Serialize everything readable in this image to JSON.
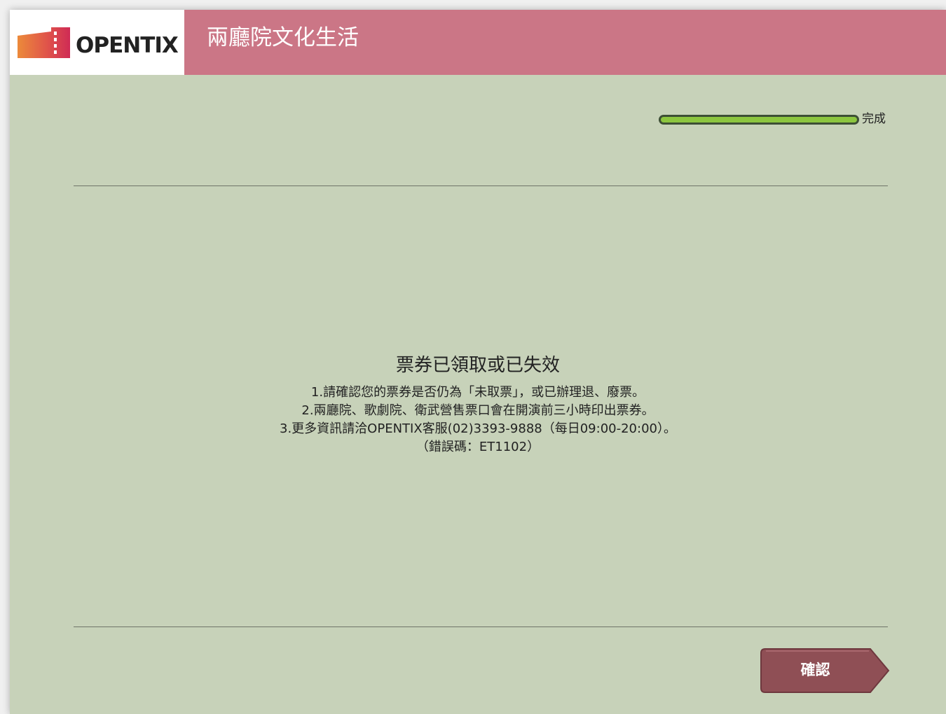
{
  "header": {
    "logo_text": "OPENTIX",
    "title": "兩廳院文化生活"
  },
  "progress": {
    "label": "完成",
    "fraction": 1.0
  },
  "message": {
    "title": "票券已領取或已失效",
    "lines": [
      "1.請確認您的票券是否仍為「未取票」，或已辦理退、廢票。",
      "2.兩廳院、歌劇院、衛武營售票口會在開演前三小時印出票券。",
      "3.更多資訊請洽OPENTIX客服(02)3393-9888（每日09:00-20:00）。",
      "（錯誤碼：ET1102）"
    ]
  },
  "footer": {
    "confirm_label": "確認"
  },
  "colors": {
    "header": "#cb7686",
    "background": "#c7d2b9",
    "progress_fill": "#8cc63f",
    "button": "#8f4f55"
  }
}
